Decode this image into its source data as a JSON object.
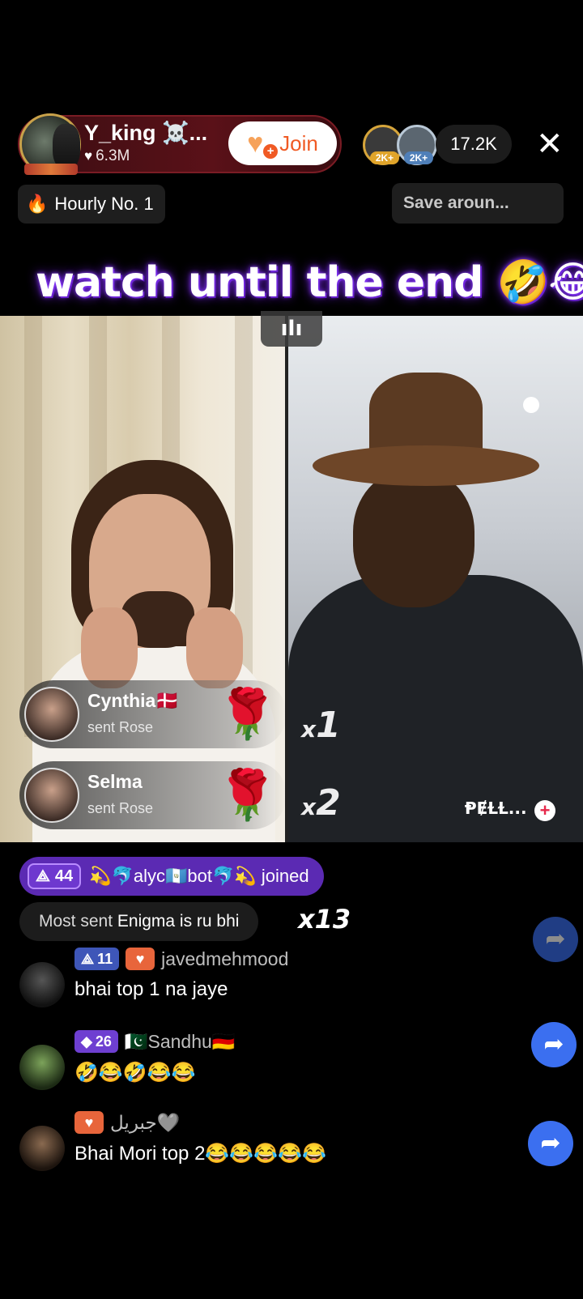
{
  "host": {
    "name": "Y_king ☠️...",
    "likes": "6.3M",
    "join_label": "Join"
  },
  "viewers": {
    "badges": [
      "2K+",
      "2K+"
    ],
    "count": "17.2K"
  },
  "hourly_label": "Hourly No. 1",
  "save_chip": "Save aroun...",
  "caption": "watch until the end 🤣😂",
  "battle": {
    "multiplier_1": "1",
    "multiplier_2": "2",
    "right_user": "ⱣɆⱢⱢ...",
    "mic_icon": "audio-bars"
  },
  "gifts": [
    {
      "name": "Cynthia🇩🇰",
      "action": "sent Rose"
    },
    {
      "name": "Selma",
      "action": "sent Rose"
    }
  ],
  "join_banner": {
    "level": "44",
    "text": "💫🐬alyc🇬🇹bot🐬💫 joined"
  },
  "most_sent": {
    "prefix": "Most sent",
    "text": "Enigma is ru bhi",
    "count": "x13"
  },
  "chat": [
    {
      "level": "11",
      "username": "javedmehmood",
      "message": "bhai top 1 na jaye"
    },
    {
      "level": "26",
      "username": "🇵🇰Sandhu🇩🇪",
      "message": "🤣😂🤣😂😂"
    },
    {
      "username": "جبريل🩶",
      "message": "Bhai Mori top 2😂😂😂😂😂"
    }
  ],
  "colors": {
    "accent_join": "#f05a24",
    "banner_purple": "#5b2ab3",
    "share_blue": "#3b6ff0"
  }
}
